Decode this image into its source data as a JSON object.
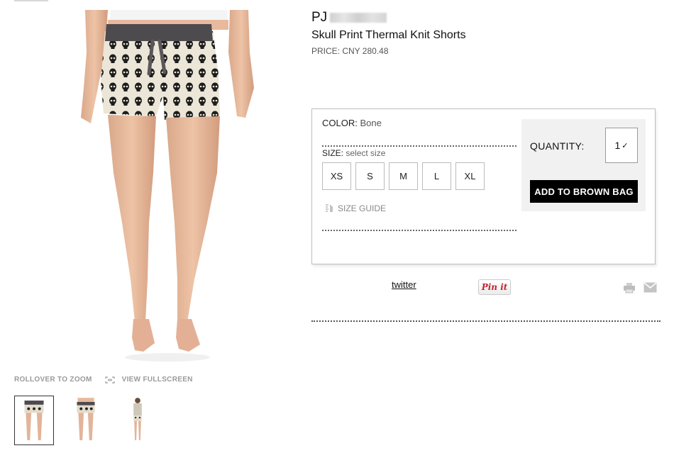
{
  "product": {
    "brand": "PJ",
    "name": "Skull Print Thermal Knit Shorts",
    "price": "PRICE: CNY 280.48"
  },
  "image_controls": {
    "zoom_label": "ROLLOVER TO ZOOM",
    "fullscreen_label": "VIEW FULLSCREEN"
  },
  "options": {
    "color_label": "COLOR:",
    "color_value": "Bone",
    "size_label": "SIZE:",
    "size_value": "select size",
    "sizes": [
      "XS",
      "S",
      "M",
      "L",
      "XL"
    ],
    "size_guide_label": "SIZE GUIDE"
  },
  "purchase": {
    "quantity_label": "QUANTITY:",
    "quantity_value": "1",
    "add_button_label": "ADD TO BROWN BAG"
  },
  "share": {
    "twitter_label": "twitter",
    "pinit_label": "Pin it"
  },
  "icons": {
    "fullscreen": "fullscreen-icon",
    "size_guide": "ruler-icon",
    "print": "printer-icon",
    "mail": "envelope-icon"
  },
  "colors": {
    "button_bg": "#000000",
    "panel_bg": "#f1f1f1",
    "pinit_red": "#c8232c"
  }
}
